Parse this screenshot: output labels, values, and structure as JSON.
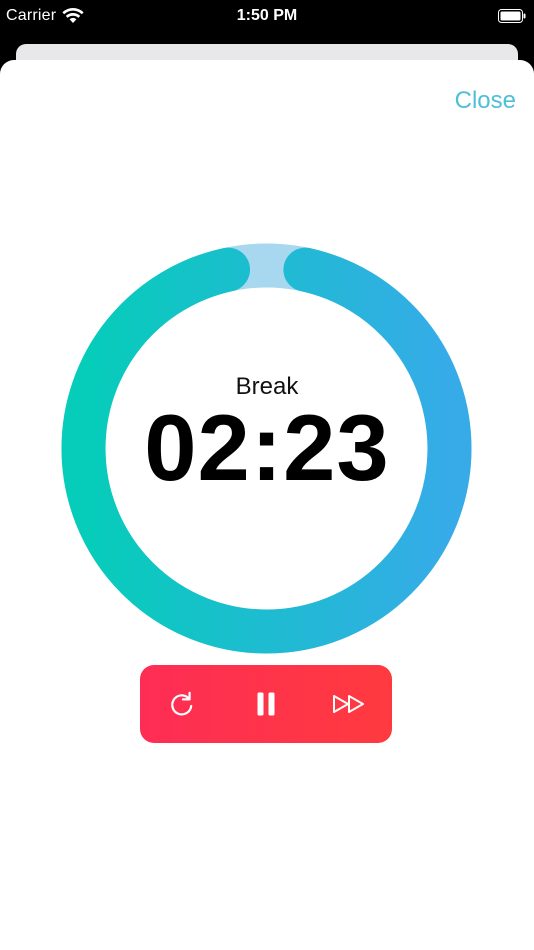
{
  "status_bar": {
    "carrier": "Carrier",
    "time": "1:50 PM"
  },
  "header": {
    "close_label": "Close"
  },
  "timer": {
    "label": "Break",
    "value": "02:23",
    "progress": 0.97,
    "colors": {
      "ring_top": "#05cdb9",
      "ring_bottom": "#36abe8",
      "track": "#a8d8f0"
    }
  },
  "controls": {
    "icons": [
      "restart-icon",
      "pause-icon",
      "skip-forward-icon"
    ],
    "background_start": "#fe2d55",
    "background_end": "#ff3a3f"
  },
  "accent_color": "#4ebfd6"
}
